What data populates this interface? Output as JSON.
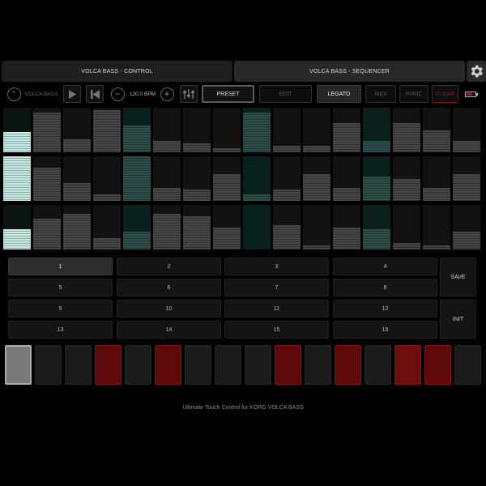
{
  "tabs": [
    {
      "label": "VOLCA BASS - CONTROL",
      "active": false
    },
    {
      "label": "VOLCA BASS - SEQUENCER",
      "active": true
    }
  ],
  "toolbar": {
    "device_label": "VOLCA BASS",
    "bpm": "120.0 BPM",
    "buttons": {
      "preset": "PRESET",
      "edit": "EDIT",
      "legato": "LEGATO",
      "midi": "MIDI",
      "panic": "PANIC",
      "clear": "CLEAR"
    }
  },
  "sequencer": {
    "current_step": 1,
    "steps": [
      {
        "n": 1,
        "levels": [
          0.45,
          1.0,
          0.45
        ],
        "state": "selected"
      },
      {
        "n": 2,
        "levels": [
          0.9,
          0.75,
          0.7
        ]
      },
      {
        "n": 3,
        "levels": [
          0.3,
          0.4,
          0.8
        ]
      },
      {
        "n": 4,
        "levels": [
          0.95,
          0.15,
          0.25
        ]
      },
      {
        "n": 5,
        "levels": [
          0.6,
          1.0,
          0.4
        ],
        "state": "current"
      },
      {
        "n": 6,
        "levels": [
          0.25,
          0.3,
          0.8
        ]
      },
      {
        "n": 7,
        "levels": [
          0.2,
          0.25,
          0.75
        ]
      },
      {
        "n": 8,
        "levels": [
          0.1,
          0.6,
          0.5
        ]
      },
      {
        "n": 9,
        "levels": [
          0.9,
          0.15,
          0.0
        ],
        "state": "current"
      },
      {
        "n": 10,
        "levels": [
          0.15,
          0.25,
          0.55
        ]
      },
      {
        "n": 11,
        "levels": [
          0.15,
          0.6,
          0.1
        ]
      },
      {
        "n": 12,
        "levels": [
          0.65,
          0.3,
          0.5
        ]
      },
      {
        "n": 13,
        "levels": [
          0.25,
          0.55,
          0.45
        ],
        "state": "current"
      },
      {
        "n": 14,
        "levels": [
          0.65,
          0.5,
          0.15
        ]
      },
      {
        "n": 15,
        "levels": [
          0.5,
          0.3,
          0.1
        ]
      },
      {
        "n": 16,
        "levels": [
          0.25,
          0.6,
          0.4
        ]
      }
    ]
  },
  "patterns": {
    "items": [
      "1",
      "2",
      "3",
      "4",
      "5",
      "6",
      "7",
      "8",
      "9",
      "10",
      "11",
      "12",
      "13",
      "14",
      "15",
      "16"
    ],
    "active": "1",
    "save_label": "SAVE",
    "init_label": "INIT"
  },
  "step_buttons": {
    "states": [
      "current",
      "off",
      "off",
      "on",
      "off",
      "on",
      "off",
      "off",
      "off",
      "on",
      "off",
      "on",
      "off",
      "on-bright",
      "on",
      "off"
    ]
  },
  "colors": {
    "accent_red": "#c1121f",
    "current_step_teal": "#0a201e",
    "selected_step": "#c6e6e2"
  },
  "footer": "Ultimate Touch Control for KORG VOLCA BASS"
}
